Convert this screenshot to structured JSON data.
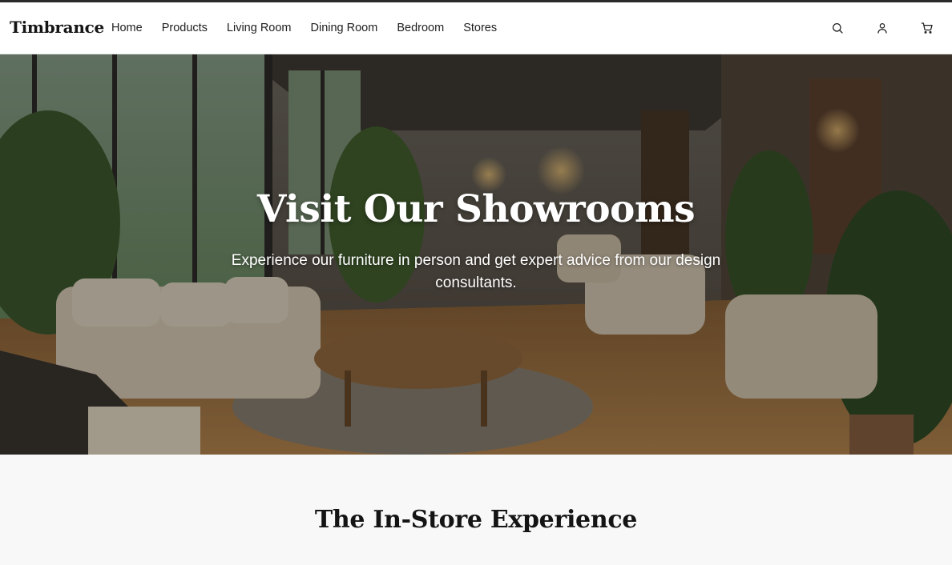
{
  "brand": {
    "name": "Timbrance"
  },
  "nav": {
    "items": [
      {
        "label": "Home"
      },
      {
        "label": "Products"
      },
      {
        "label": "Living Room"
      },
      {
        "label": "Dining Room"
      },
      {
        "label": "Bedroom"
      },
      {
        "label": "Stores"
      }
    ]
  },
  "header_icons": [
    "search-icon",
    "user-icon",
    "cart-icon"
  ],
  "hero": {
    "title": "Visit Our Showrooms",
    "subtitle": "Experience our furniture in person and get expert advice from our design consultants.",
    "image": "showroom-photo"
  },
  "section": {
    "title": "The In-Store Experience"
  },
  "colors": {
    "header_bg": "#ffffff",
    "page_bg": "#f8f8f8",
    "text": "#1a1a1a",
    "hero_text": "#ffffff"
  }
}
